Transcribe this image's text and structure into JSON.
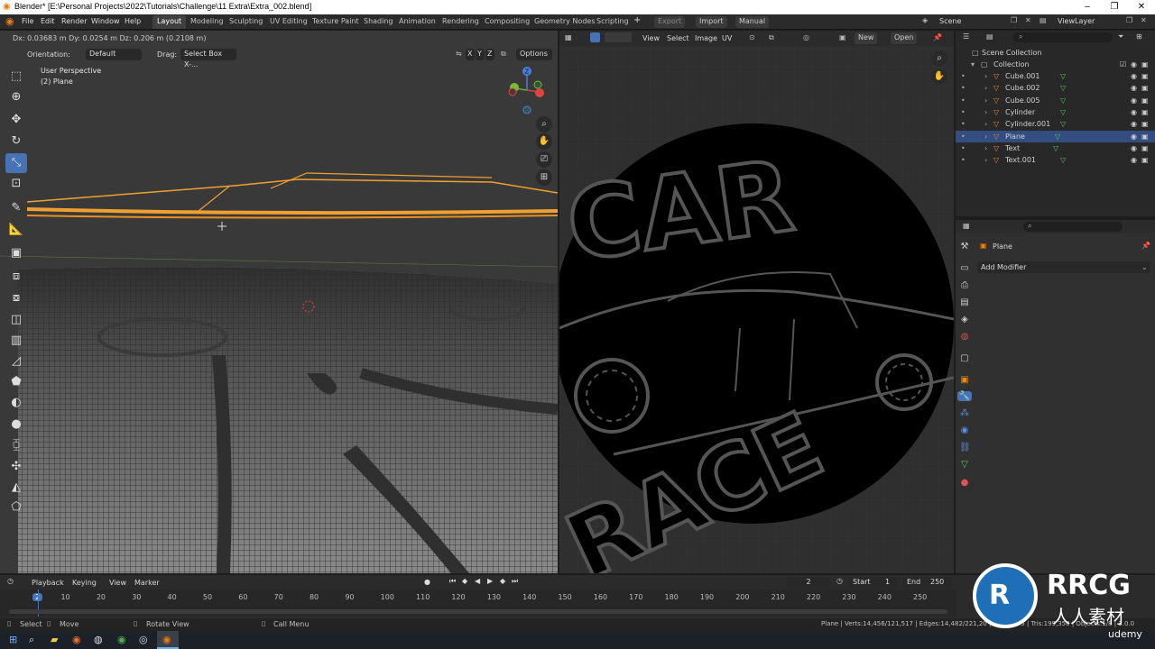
{
  "window": {
    "title": "Blender* [E:\\Personal Projects\\2022\\Tutorials\\Challenge\\11 Extra\\Extra_002.blend]"
  },
  "menus": [
    "File",
    "Edit",
    "Render",
    "Window",
    "Help"
  ],
  "workspaces": [
    "Layout",
    "Modeling",
    "Sculpting",
    "UV Editing",
    "Texture Paint",
    "Shading",
    "Animation",
    "Rendering",
    "Compositing",
    "Geometry Nodes",
    "Scripting"
  ],
  "topbar_right": {
    "export": "Export",
    "import": "Import",
    "manual": "Manual",
    "scene": "Scene",
    "view_layer": "ViewLayer"
  },
  "viewport": {
    "transform_info": "Dx: 0.03683 m   Dy: 0.0254 m   Dz: 0.206 m (0.2108 m)",
    "orientation_label": "Orientation:",
    "orientation_value": "Default",
    "drag_label": "Drag:",
    "drag_value": "Select Box X-...",
    "axes": [
      "X",
      "Y",
      "Z"
    ],
    "options": "Options",
    "overlay_title": "User Perspective",
    "overlay_object": "(2) Plane"
  },
  "uv_editor": {
    "menus": [
      "View",
      "Select",
      "Image",
      "UV"
    ],
    "new": "New",
    "open": "Open"
  },
  "outliner": {
    "root": "Scene Collection",
    "collection": "Collection",
    "items": [
      "Cube.001",
      "Cube.002",
      "Cube.005",
      "Cylinder",
      "Cylinder.001",
      "Plane",
      "Text",
      "Text.001"
    ]
  },
  "properties": {
    "object": "Plane",
    "add_modifier": "Add Modifier"
  },
  "timeline": {
    "menus": [
      "Playback",
      "Keying",
      "View",
      "Marker"
    ],
    "current_frame": "2",
    "start_label": "Start",
    "start": "1",
    "end_label": "End",
    "end": "250",
    "ticks": [
      "2",
      "10",
      "20",
      "30",
      "40",
      "50",
      "60",
      "70",
      "80",
      "90",
      "100",
      "110",
      "120",
      "130",
      "140",
      "150",
      "160",
      "170",
      "180",
      "190",
      "200",
      "210",
      "220",
      "230",
      "240",
      "250"
    ]
  },
  "statusbar": {
    "select": "Select",
    "move": "Move",
    "rotate": "Rotate View",
    "call_menu": "Call Menu",
    "stats": "Plane | Verts:14,456/121,517 | Edges:14,482/221,20 | Faces:675 | Tris:199,350 | Objects:1/8 | 3.0.0"
  },
  "uv_text": {
    "top": "CAR",
    "bottom": "RACE"
  },
  "watermark": {
    "brand": "RRCG",
    "sub": "人人素材",
    "udemy": "udemy"
  },
  "colors": {
    "accent": "#4772b3",
    "selection": "#f0a030",
    "bg": "#393939"
  }
}
